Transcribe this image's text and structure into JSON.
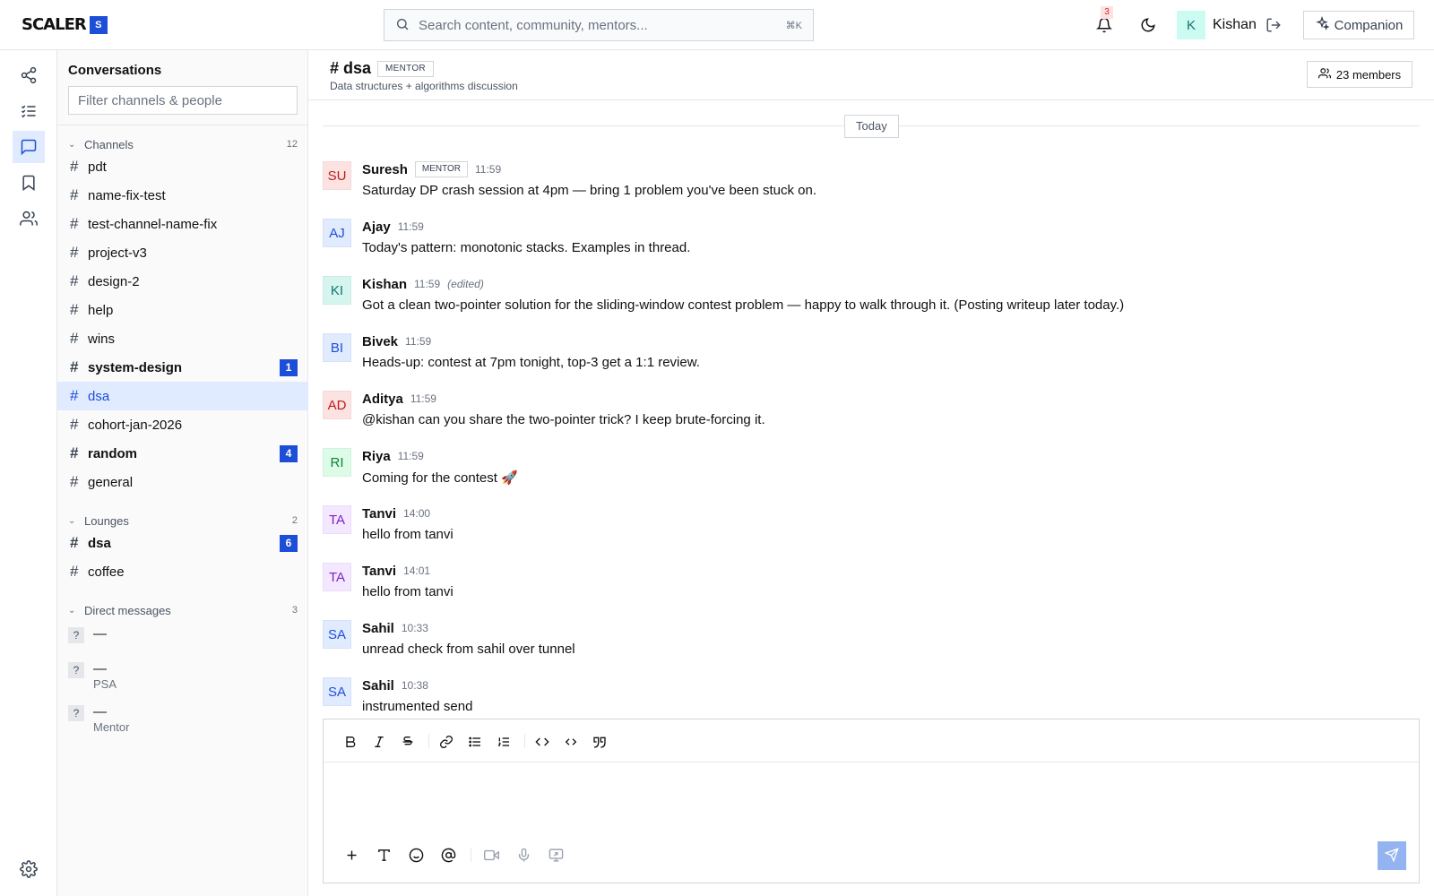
{
  "brand": {
    "name": "SCALER",
    "mark": "S"
  },
  "search": {
    "placeholder": "Search content, community, mentors...",
    "shortcut": "⌘K"
  },
  "notifications": {
    "count": "3"
  },
  "user": {
    "initial": "K",
    "name": "Kishan"
  },
  "companion": {
    "label": "Companion"
  },
  "rail": {
    "items": [
      {
        "icon": "share-network-icon"
      },
      {
        "icon": "checklist-icon"
      },
      {
        "icon": "chat-bubble-icon",
        "active": true
      },
      {
        "icon": "bookmark-icon"
      },
      {
        "icon": "users-icon"
      }
    ],
    "settings_icon": "gear-icon"
  },
  "sidebar": {
    "title": "Conversations",
    "filter_placeholder": "Filter channels & people",
    "channels": {
      "label": "Channels",
      "count": "12",
      "items": [
        {
          "name": "pdt"
        },
        {
          "name": "name-fix-test"
        },
        {
          "name": "test-channel-name-fix"
        },
        {
          "name": "project-v3"
        },
        {
          "name": "design-2"
        },
        {
          "name": "help"
        },
        {
          "name": "wins"
        },
        {
          "name": "system-design",
          "badge": "1",
          "bold": true
        },
        {
          "name": "dsa",
          "active": true
        },
        {
          "name": "cohort-jan-2026"
        },
        {
          "name": "random",
          "badge": "4",
          "bold": true
        },
        {
          "name": "general"
        }
      ]
    },
    "lounges": {
      "label": "Lounges",
      "count": "2",
      "items": [
        {
          "name": "dsa",
          "badge": "6",
          "bold": true
        },
        {
          "name": "coffee"
        }
      ]
    },
    "dms": {
      "label": "Direct messages",
      "count": "3",
      "items": [
        {
          "avatar": "?",
          "name": "—",
          "sub": ""
        },
        {
          "avatar": "?",
          "name": "—",
          "sub": "PSA"
        },
        {
          "avatar": "?",
          "name": "—",
          "sub": "Mentor"
        }
      ]
    }
  },
  "channel": {
    "name": "# dsa",
    "tag": "MENTOR",
    "description": "Data structures + algorithms discussion",
    "members_label": "23 members"
  },
  "day_label": "Today",
  "messages": [
    {
      "initials": "SU",
      "author": "Suresh",
      "tag": "MENTOR",
      "time": "11:59",
      "edited": "",
      "text": "Saturday DP crash session at 4pm — bring 1 problem you've been stuck on.",
      "bg": "#fde2e2",
      "fg": "#b91c1c"
    },
    {
      "initials": "AJ",
      "author": "Ajay",
      "tag": "",
      "time": "11:59",
      "edited": "",
      "text": "Today's pattern: monotonic stacks. Examples in thread.",
      "bg": "#e0ebff",
      "fg": "#1d4ed8"
    },
    {
      "initials": "KI",
      "author": "Kishan",
      "tag": "",
      "time": "11:59",
      "edited": "(edited)",
      "text": "Got a clean two-pointer solution for the sliding-window contest problem — happy to walk through it. (Posting writeup later today.)",
      "bg": "#d5f5ee",
      "fg": "#0f766e"
    },
    {
      "initials": "BI",
      "author": "Bivek",
      "tag": "",
      "time": "11:59",
      "edited": "",
      "text": "Heads-up: contest at 7pm tonight, top-3 get a 1:1 review.",
      "bg": "#e0ebff",
      "fg": "#1d4ed8"
    },
    {
      "initials": "AD",
      "author": "Aditya",
      "tag": "",
      "time": "11:59",
      "edited": "",
      "text": "@kishan can you share the two-pointer trick? I keep brute-forcing it.",
      "bg": "#fde2e2",
      "fg": "#b91c1c"
    },
    {
      "initials": "RI",
      "author": "Riya",
      "tag": "",
      "time": "11:59",
      "edited": "",
      "text": "Coming for the contest 🚀",
      "bg": "#dcfce7",
      "fg": "#15803d"
    },
    {
      "initials": "TA",
      "author": "Tanvi",
      "tag": "",
      "time": "14:00",
      "edited": "",
      "text": "hello from tanvi",
      "bg": "#f3e8ff",
      "fg": "#7e22ce"
    },
    {
      "initials": "TA",
      "author": "Tanvi",
      "tag": "",
      "time": "14:01",
      "edited": "",
      "text": "hello from tanvi",
      "bg": "#f3e8ff",
      "fg": "#7e22ce"
    },
    {
      "initials": "SA",
      "author": "Sahil",
      "tag": "",
      "time": "10:33",
      "edited": "",
      "text": "unread check from sahil over tunnel",
      "bg": "#e0ebff",
      "fg": "#1d4ed8"
    },
    {
      "initials": "SA",
      "author": "Sahil",
      "tag": "",
      "time": "10:38",
      "edited": "",
      "text": "instrumented send",
      "bg": "#e0ebff",
      "fg": "#1d4ed8"
    }
  ],
  "composer": {
    "format_tools": [
      "bold-icon",
      "italic-icon",
      "strikethrough-icon",
      "link-icon",
      "bullet-list-icon",
      "numbered-list-icon",
      "code-icon",
      "code-block-icon",
      "quote-icon"
    ],
    "actions": [
      "plus-icon",
      "text-format-icon",
      "emoji-icon",
      "mention-icon",
      "video-icon",
      "microphone-icon",
      "screen-share-icon"
    ],
    "send_icon": "send-icon"
  },
  "colors": {
    "accent": "#1d4ed8",
    "accent_light": "#e0ebff",
    "send_disabled": "#93b4f0",
    "border": "#e5e7eb"
  }
}
